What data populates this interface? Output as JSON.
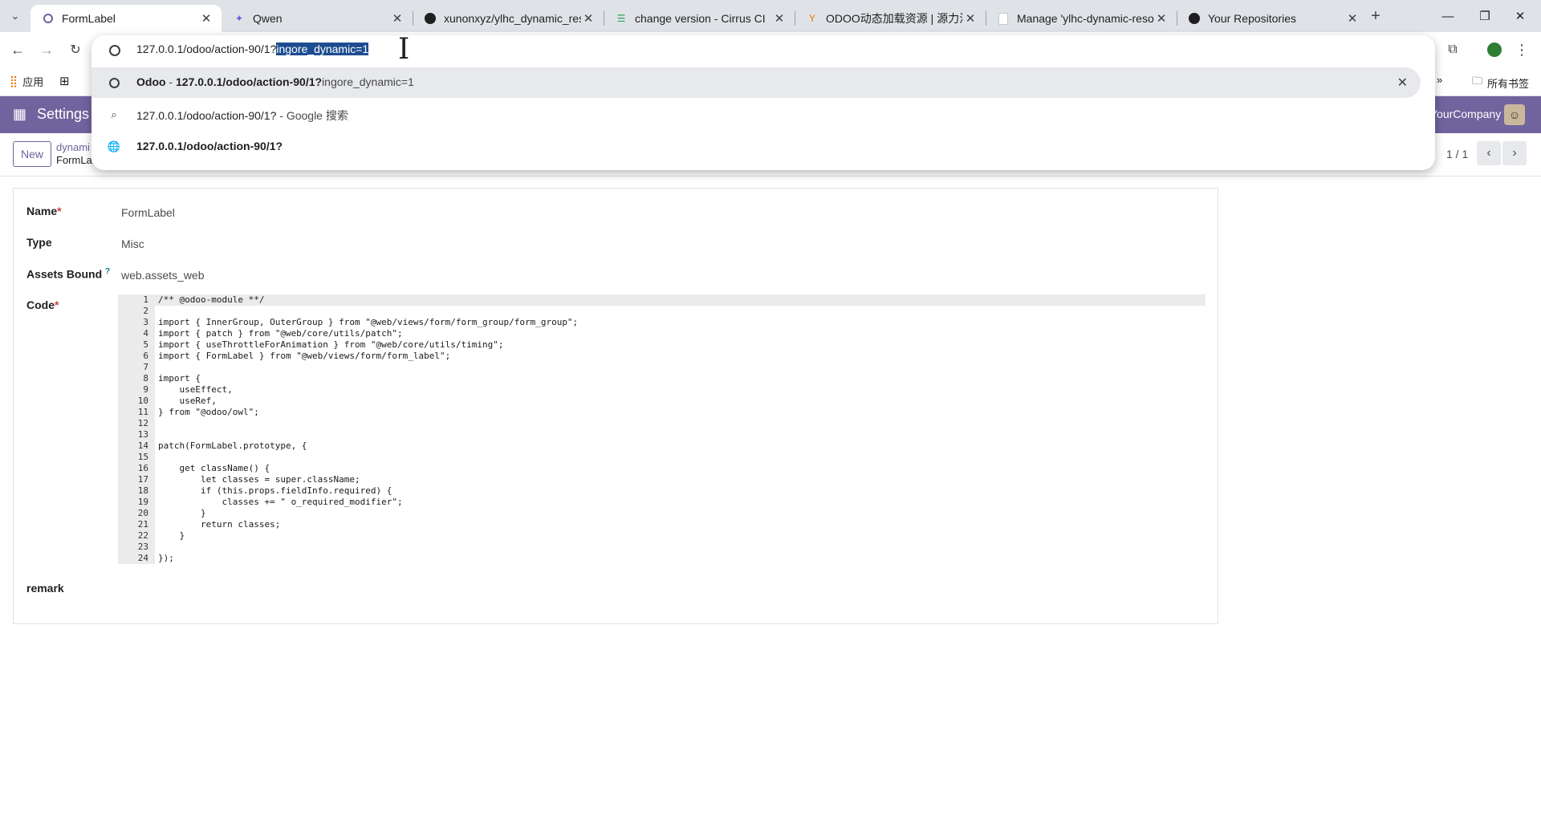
{
  "browser": {
    "tabs": [
      {
        "title": "FormLabel",
        "icon": "odoo-ring-icon",
        "active": true
      },
      {
        "title": "Qwen",
        "icon": "qwen-icon",
        "active": false
      },
      {
        "title": "xunonxyz/ylhc_dynamic_reso",
        "icon": "github-icon",
        "active": false
      },
      {
        "title": "change version - Cirrus CI",
        "icon": "cirrus-icon",
        "active": false
      },
      {
        "title": "ODOO动态加载资源 | 源力汇",
        "icon": "odoo-y-icon",
        "active": false
      },
      {
        "title": "Manage 'ylhc-dynamic-resou",
        "icon": "page-icon",
        "active": false
      },
      {
        "title": "Your Repositories",
        "icon": "github-icon",
        "active": false
      }
    ],
    "omnibox": {
      "text_plain": "127.0.0.1/odoo/action-90/1?",
      "text_selected": "ingore_dynamic=1",
      "suggestions": [
        {
          "bold": "Odoo",
          "sep": " - ",
          "url_bold": "127.0.0.1/odoo/action-90/1?",
          "url_rest": "ingore_dynamic=1",
          "icon": "history-icon"
        },
        {
          "text": "127.0.0.1/odoo/action-90/1?",
          "suffix": " - Google 搜索",
          "icon": "search-icon"
        },
        {
          "text": "127.0.0.1/odoo/action-90/1?",
          "icon": "globe-icon"
        }
      ]
    },
    "bookmarks": {
      "apps": "应用",
      "all_bookmarks": "所有书签"
    }
  },
  "odoo": {
    "app_name": "Settings",
    "company": "YourCompany",
    "new_button": "New",
    "breadcrumb_parent": "dynami",
    "breadcrumb_current": "FormLabel",
    "pager": "1 / 1",
    "accent_color": "#71639e"
  },
  "form": {
    "name_label": "Name",
    "name_value": "FormLabel",
    "type_label": "Type",
    "type_value": "Misc",
    "assets_label": "Assets Bound",
    "assets_help": "?",
    "assets_value": "web.assets_web",
    "code_label": "Code",
    "remark_label": "remark",
    "required_mark": "*",
    "code_lines": [
      "/** @odoo-module **/",
      "",
      "import { InnerGroup, OuterGroup } from \"@web/views/form/form_group/form_group\";",
      "import { patch } from \"@web/core/utils/patch\";",
      "import { useThrottleForAnimation } from \"@web/core/utils/timing\";",
      "import { FormLabel } from \"@web/views/form/form_label\";",
      "",
      "import {",
      "    useEffect,",
      "    useRef,",
      "} from \"@odoo/owl\";",
      "",
      "",
      "patch(FormLabel.prototype, {",
      "",
      "    get className() {",
      "        let classes = super.className;",
      "        if (this.props.fieldInfo.required) {",
      "            classes += \" o_required_modifier\";",
      "        }",
      "        return classes;",
      "    }",
      "",
      "});"
    ]
  }
}
